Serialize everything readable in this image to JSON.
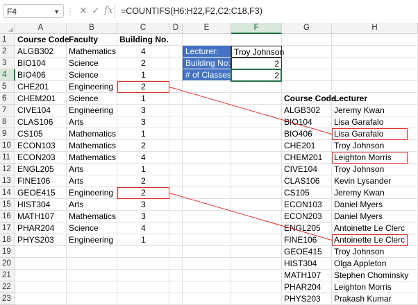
{
  "formula_bar": {
    "name_box": "F4",
    "formula": "=COUNTIFS(H6:H22,F2,C2:C18,F3)",
    "icons": [
      "cancel-icon",
      "enter-icon",
      "fx-icon"
    ]
  },
  "columns": [
    "A",
    "B",
    "C",
    "D",
    "E",
    "F",
    "G",
    "H"
  ],
  "rows": [
    "1",
    "2",
    "3",
    "4",
    "5",
    "6",
    "7",
    "8",
    "9",
    "10",
    "11",
    "12",
    "13",
    "14",
    "15",
    "16",
    "17",
    "18",
    "19",
    "20",
    "21",
    "22",
    "23"
  ],
  "table1": {
    "headers": [
      "Course Code",
      "Faculty",
      "Building No."
    ],
    "rows": [
      [
        "ALGB302",
        "Mathematics",
        "4"
      ],
      [
        "BIO104",
        "Science",
        "2"
      ],
      [
        "BIO406",
        "Science",
        "1"
      ],
      [
        "CHE201",
        "Engineering",
        "2"
      ],
      [
        "CHEM201",
        "Science",
        "1"
      ],
      [
        "CIVE104",
        "Engineering",
        "3"
      ],
      [
        "CLAS106",
        "Arts",
        "3"
      ],
      [
        "CS105",
        "Mathematics",
        "1"
      ],
      [
        "ECON103",
        "Mathematics",
        "2"
      ],
      [
        "ECON203",
        "Mathematics",
        "4"
      ],
      [
        "ENGL205",
        "Arts",
        "1"
      ],
      [
        "FINE106",
        "Arts",
        "2"
      ],
      [
        "GEOE415",
        "Engineering",
        "2"
      ],
      [
        "HIST304",
        "Arts",
        "3"
      ],
      [
        "MATH107",
        "Mathematics",
        "3"
      ],
      [
        "PHAR204",
        "Science",
        "4"
      ],
      [
        "PHYS203",
        "Engineering",
        "1"
      ]
    ]
  },
  "criteria": {
    "rows": [
      {
        "label": "Lecturer:",
        "value": "Troy Johnson"
      },
      {
        "label": "Building No:",
        "value": "2"
      },
      {
        "label": "# of Classes",
        "value": "2"
      }
    ]
  },
  "table2": {
    "headers": [
      "Course Code",
      "Lecturer"
    ],
    "rows": [
      [
        "ALGB302",
        "Jeremy Kwan"
      ],
      [
        "BIO104",
        "Lisa Garafalo"
      ],
      [
        "BIO406",
        "Lisa Garafalo"
      ],
      [
        "CHE201",
        "Troy Johnson"
      ],
      [
        "CHEM201",
        "Leighton Morris"
      ],
      [
        "CIVE104",
        "Troy Johnson"
      ],
      [
        "CLAS106",
        "Kevin Lysander"
      ],
      [
        "CS105",
        "Jeremy Kwan"
      ],
      [
        "ECON103",
        "Daniel Myers"
      ],
      [
        "ECON203",
        "Daniel Myers"
      ],
      [
        "ENGL205",
        "Antoinette Le Clerc"
      ],
      [
        "FINE106",
        "Antoinette Le Clerc"
      ],
      [
        "GEOE415",
        "Troy Johnson"
      ],
      [
        "HIST304",
        "Olga Appleton"
      ],
      [
        "MATH107",
        "Stephen Chominsky"
      ],
      [
        "PHAR204",
        "Leighton Morris"
      ],
      [
        "PHYS203",
        "Prakash Kumar"
      ]
    ]
  },
  "colors": {
    "accent": "#217346",
    "criteria_fill": "#4472c4",
    "highlight": "#e0302e"
  }
}
